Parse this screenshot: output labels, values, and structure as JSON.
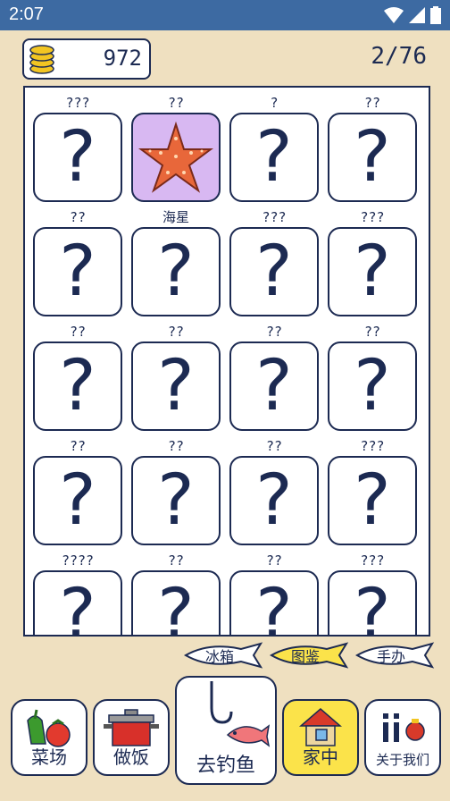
{
  "status": {
    "time": "2:07"
  },
  "coins": "972",
  "progress": "2/76",
  "grid": [
    {
      "label": "???",
      "found": false
    },
    {
      "label": "??",
      "found": true,
      "name": "starfish"
    },
    {
      "label": "?",
      "found": false
    },
    {
      "label": "??",
      "found": false
    },
    {
      "label": "??",
      "found": false
    },
    {
      "label": "海星",
      "found": false
    },
    {
      "label": "???",
      "found": false
    },
    {
      "label": "???",
      "found": false
    },
    {
      "label": "??",
      "found": false
    },
    {
      "label": "??",
      "found": false
    },
    {
      "label": "??",
      "found": false
    },
    {
      "label": "??",
      "found": false
    },
    {
      "label": "??",
      "found": false
    },
    {
      "label": "??",
      "found": false
    },
    {
      "label": "??",
      "found": false
    },
    {
      "label": "???",
      "found": false
    },
    {
      "label": "????",
      "found": false
    },
    {
      "label": "??",
      "found": false
    },
    {
      "label": "??",
      "found": false
    },
    {
      "label": "???",
      "found": false
    }
  ],
  "question_mark": "?",
  "tabs": {
    "fridge": "冰箱",
    "collection": "图鉴",
    "figures": "手办"
  },
  "nav": {
    "farm": "菜场",
    "cook": "做饭",
    "fish": "去钓鱼",
    "home": "家中",
    "about": "关于我们"
  },
  "colors": {
    "accent": "#fbe34a",
    "ink": "#1c2a52",
    "found_bg": "#d8b8f2"
  }
}
